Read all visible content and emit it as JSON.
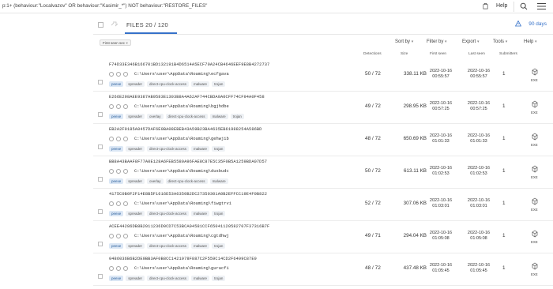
{
  "search": {
    "query": "p:1+ (behaviour:\"Localvazov\" OR behaviour:\"Kasimir_*\") NOT behaviour:\"RESTORE_FILES\""
  },
  "topbar": {
    "help_label": "Help"
  },
  "header": {
    "files_label": "FILES  20 / 120",
    "days_label": "90 days"
  },
  "filter_chip": "First seen sec ×",
  "controls": {
    "sort_by": "Sort by",
    "filter_by": "Filter by",
    "export": "Export",
    "tools": "Tools",
    "help": "Help"
  },
  "columns": {
    "detections": "Detections",
    "size": "Size",
    "first_seen": "First seen",
    "last_seen": "Last seen",
    "submitters": "Submitters"
  },
  "rows": [
    {
      "hash": "F74D33E346B166701BD132191B4D6514A5ECF70A24CB4646EEF9E8B4272737",
      "path": "C:\\Users\\user\\AppData\\Roaming\\ecfgava",
      "tags": [
        "peexe",
        "spreader",
        "direct-cpu-clock-access",
        "malware",
        "trojan"
      ],
      "detections": "50 / 72",
      "size": "338.11 KB",
      "first_date": "2022-10-16",
      "first_time": "00:55:57",
      "last_date": "2022-10-16",
      "last_time": "00:55:57",
      "submitters": "1",
      "type": "EXE"
    },
    {
      "hash": "E266E298AEE9387AB9583E1303B8A4A62AF744CBDA0A0CFF74CF94A0F458",
      "path": "C:\\Users\\user\\AppData\\Roaming\\bgjhdbe",
      "tags": [
        "peexe",
        "spreader",
        "overlay",
        "direct-cpu-clock-access",
        "malware",
        "trojan"
      ],
      "detections": "49 / 72",
      "size": "298.95 KB",
      "first_date": "2022-10-16",
      "first_time": "00:57:25",
      "last_date": "2022-10-16",
      "last_time": "00:57:25",
      "submitters": "1",
      "type": "EXE"
    },
    {
      "hash": "EB2A2F9185A0457DAF6E0BA08EBEB43A59B23BA4635EB61988254A586BD",
      "path": "C:\\Users\\user\\AppData\\Roaming\\gehwjib",
      "tags": [
        "peexe",
        "spreader",
        "direct-cpu-clock-access",
        "malware",
        "trojan"
      ],
      "detections": "48 / 72",
      "size": "650.69 KB",
      "first_date": "2022-10-16",
      "first_time": "01:01:33",
      "last_date": "2022-10-16",
      "last_time": "01:01:33",
      "submitters": "1",
      "type": "EXE"
    },
    {
      "hash": "BB8A43BAAF8F77A0E128A6FEB5580A96FAE8C87E5C35F0B5A1259BDA07D57",
      "path": "C:\\Users\\user\\AppData\\Roaming\\dusbudc",
      "tags": [
        "peexe",
        "spreader",
        "overlay",
        "direct-cpu-clock-access",
        "malware"
      ],
      "detections": "50 / 72",
      "size": "613.11 KB",
      "first_date": "2022-10-16",
      "first_time": "01:02:53",
      "last_date": "2022-10-16",
      "last_time": "01:02:53",
      "submitters": "1",
      "type": "EXE"
    },
    {
      "hash": "4175C0B0F2F14E8B5F1616E53A6350B2DC27350301A0B2EFFCC19E4F0B822",
      "path": "C:\\Users\\user\\AppData\\Roaming\\fiwgtrvi",
      "tags": [
        "peexe",
        "spreader",
        "direct-cpu-clock-access",
        "malware",
        "trojan"
      ],
      "detections": "52 / 72",
      "size": "307.06 KB",
      "first_date": "2022-10-16",
      "first_time": "01:03:01",
      "last_date": "2022-10-16",
      "last_time": "01:03:01",
      "submitters": "1",
      "type": "EXE"
    },
    {
      "hash": "ACEE44286DB8B2011236D0CD7C53BCA04581CCF65041120582707F37316B7F",
      "path": "C:\\Users\\user\\AppData\\Roaming\\cgtdhwj",
      "tags": [
        "peexe",
        "spreader",
        "direct-cpu-clock-access",
        "malware",
        "trojan"
      ],
      "detections": "49 / 71",
      "size": "294.04 KB",
      "first_date": "2022-10-16",
      "first_time": "01:05:08",
      "last_date": "2022-10-16",
      "last_time": "01:05:08",
      "submitters": "1",
      "type": "EXE"
    },
    {
      "hash": "0486036B6B2DE9BB3AF0B8CC1421978F887C2F559C14CD2F6499C87E9",
      "path": "C:\\Users\\user\\AppData\\Roaming\\guracfi",
      "tags": [
        "peexe",
        "spreader",
        "direct-cpu-clock-access",
        "malware",
        "trojan"
      ],
      "detections": "48 / 72",
      "size": "437.48 KB",
      "first_date": "2022-10-16",
      "first_time": "01:05:45",
      "last_date": "2022-10-16",
      "last_time": "01:05:45",
      "submitters": "1",
      "type": "EXE"
    }
  ]
}
